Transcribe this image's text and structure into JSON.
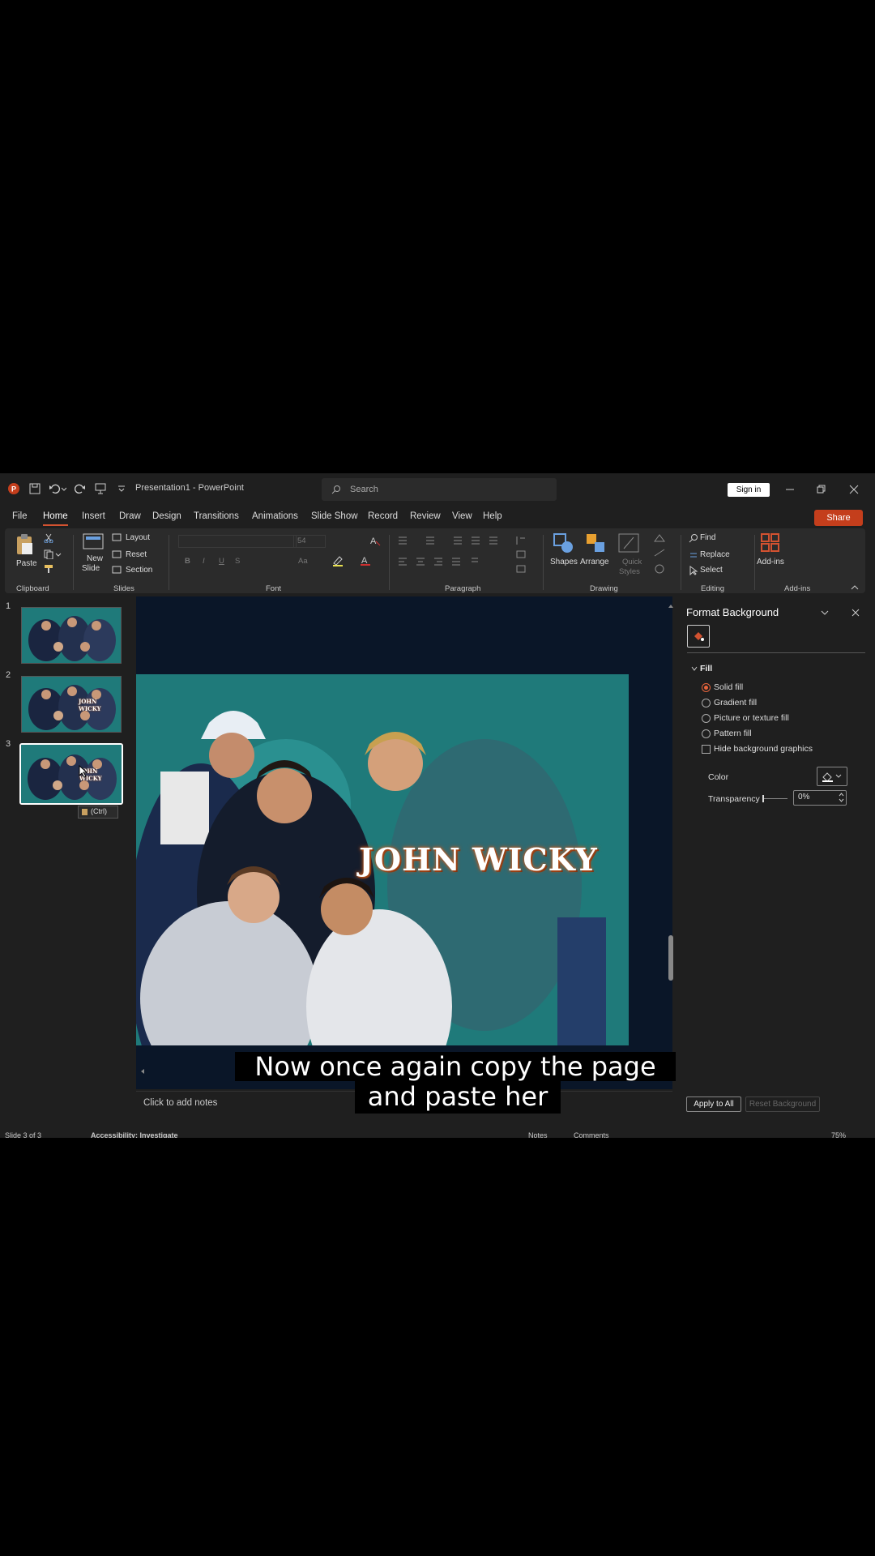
{
  "titlebar": {
    "doc_title": "Presentation1 - PowerPoint",
    "search_placeholder": "Search",
    "sign_in": "Sign in"
  },
  "menu": {
    "items": [
      "File",
      "Home",
      "Insert",
      "Draw",
      "Design",
      "Transitions",
      "Animations",
      "Slide Show",
      "Record",
      "Review",
      "View",
      "Help"
    ],
    "active": "Home",
    "share": "Share"
  },
  "ribbon": {
    "clipboard": {
      "paste": "Paste",
      "label": "Clipboard"
    },
    "slides": {
      "new_slide_1": "New",
      "new_slide_2": "Slide",
      "layout": "Layout",
      "reset": "Reset",
      "section": "Section",
      "label": "Slides"
    },
    "font": {
      "size": "54",
      "label": "Font",
      "bold": "B",
      "italic": "I",
      "underline": "U",
      "strike": "S",
      "aa": "Aa"
    },
    "paragraph": {
      "label": "Paragraph"
    },
    "drawing": {
      "shapes": "Shapes",
      "arrange": "Arrange",
      "quick_1": "Quick",
      "quick_2": "Styles",
      "label": "Drawing"
    },
    "editing": {
      "find": "Find",
      "replace": "Replace",
      "select": "Select",
      "label": "Editing"
    },
    "addins": {
      "addins": "Add-ins",
      "label": "Add-ins"
    }
  },
  "thumbnails": {
    "numbers": [
      "1",
      "2",
      "3"
    ],
    "paste_options": "(Ctrl)",
    "thumb_text": "JOHN WICKY"
  },
  "slide": {
    "title_text": "JOHN WICKY",
    "notes_placeholder": "Click to add notes"
  },
  "format_pane": {
    "title": "Format Background",
    "section": "Fill",
    "options": [
      "Solid fill",
      "Gradient fill",
      "Picture or texture fill",
      "Pattern fill"
    ],
    "checkbox": "Hide background graphics",
    "color_label": "Color",
    "transparency_label": "Transparency",
    "transparency_value": "0%",
    "apply_all": "Apply to All",
    "reset_bg": "Reset Background"
  },
  "status": {
    "slide_info": "Slide 3 of 3",
    "accessibility": "Accessibility: Investigate",
    "notes": "Notes",
    "comments": "Comments",
    "zoom": "75%"
  },
  "caption": {
    "line1": "Now once again copy the page",
    "line2": "and paste her"
  },
  "colors": {
    "accent": "#d35230",
    "share": "#c43e1c",
    "slide_bg": "#1f7a7a",
    "canvas_bg": "#0a1628"
  }
}
